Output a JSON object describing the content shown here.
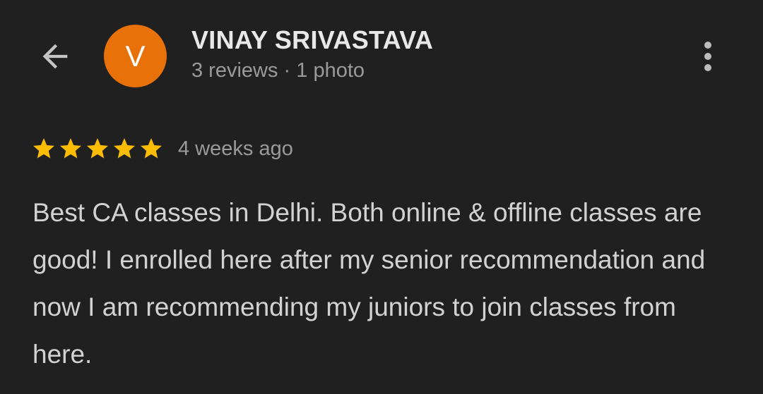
{
  "header": {
    "back_icon": "arrow-left-icon",
    "more_icon": "more-vert-icon"
  },
  "user": {
    "avatar_letter": "V",
    "avatar_color": "#E8710A",
    "name": "VINAY SRIVASTAVA",
    "meta": "3 reviews · 1 photo"
  },
  "review": {
    "rating": 5,
    "max_rating": 5,
    "star_color": "#FBBC04",
    "time": "4 weeks ago",
    "text": "Best CA classes in Delhi. Both online & offline classes are good! I enrolled here after my senior recommendation and now I am recommending my juniors to join classes from here."
  }
}
